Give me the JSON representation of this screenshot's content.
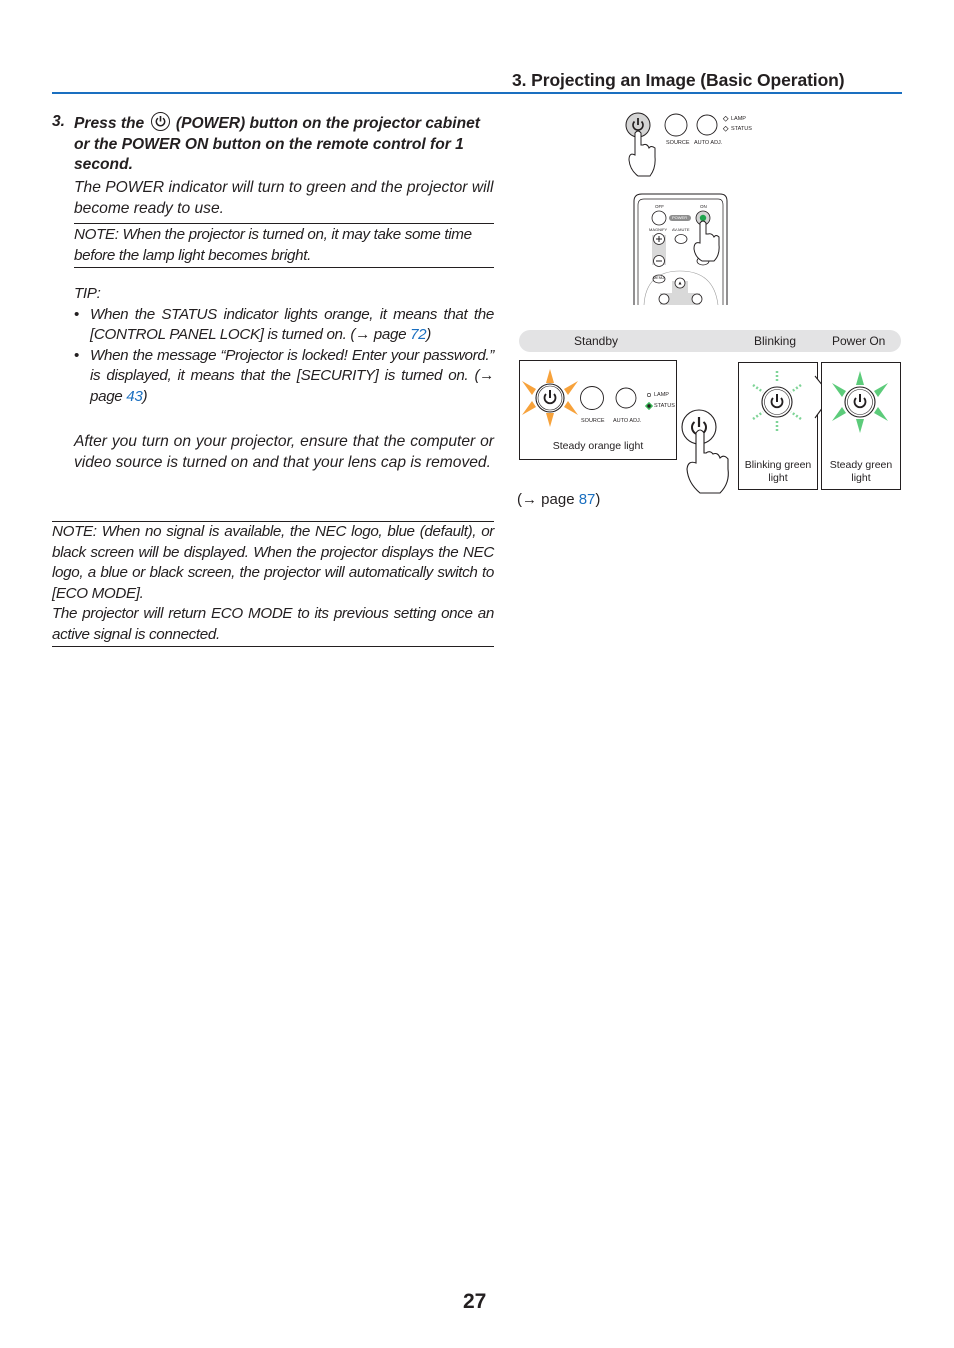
{
  "header": {
    "section_title": "3. Projecting an Image (Basic Operation)",
    "rule_color": "#1a6fc0"
  },
  "step": {
    "number": "3.",
    "text_before_icon": "Press the",
    "icon": "power-icon",
    "text_after_icon": "(POWER) button on the projector cabinet or the POWER ON button on the remote control for 1 second."
  },
  "paragraph1": "The POWER indicator will turn to green and the projector will become ready to use.",
  "note1": "NOTE: When the projector is turned on, it may take some time before the lamp light becomes bright.",
  "tip": {
    "label": "TIP:",
    "bullets": [
      {
        "text": "When the STATUS indicator lights orange, it means that the [CONTROL PANEL LOCK] is turned on. (→ page ",
        "page": "72",
        "close": ")"
      },
      {
        "text": "When the message “Projector is locked! Enter your password.” is displayed, it means that the [SECURITY] is turned on. (→ page ",
        "page": "43",
        "close": ")"
      }
    ]
  },
  "paragraph2": "After you turn on your projector, ensure that the computer or video source is turned on and that your lens cap is removed.",
  "note2": {
    "line1": "NOTE: When no signal is available, the NEC logo, blue (default), or black screen will be displayed. When the projector displays the NEC logo, a blue or black screen, the projector will automatically switch to [ECO MODE].",
    "line2": "The projector will return ECO MODE to its previous setting once an active signal is connected."
  },
  "illustration": {
    "cabinet_labels": {
      "source": "SOURCE",
      "auto_adj": "AUTO ADJ.",
      "lamp": "LAMP",
      "status": "STATUS"
    },
    "remote_labels": {
      "off": "OFF",
      "on": "ON",
      "power": "POWER",
      "magnify": "MAGNIFY",
      "av_mute": "AV-MUTE",
      "menu": "MENU"
    },
    "status_bar": {
      "standby": "Standby",
      "blinking": "Blinking",
      "power_on": "Power On"
    },
    "captions": {
      "standby": "Steady orange light",
      "blinking": "Blinking green light",
      "power_on": "Steady green light"
    },
    "colors": {
      "orange": "#f7a23b",
      "green": "#3dbb5a",
      "status_bar": "#e3e3e4"
    },
    "page_ref": {
      "prefix": "(→ page ",
      "page": "87",
      "suffix": ")"
    }
  },
  "page_number": "27"
}
